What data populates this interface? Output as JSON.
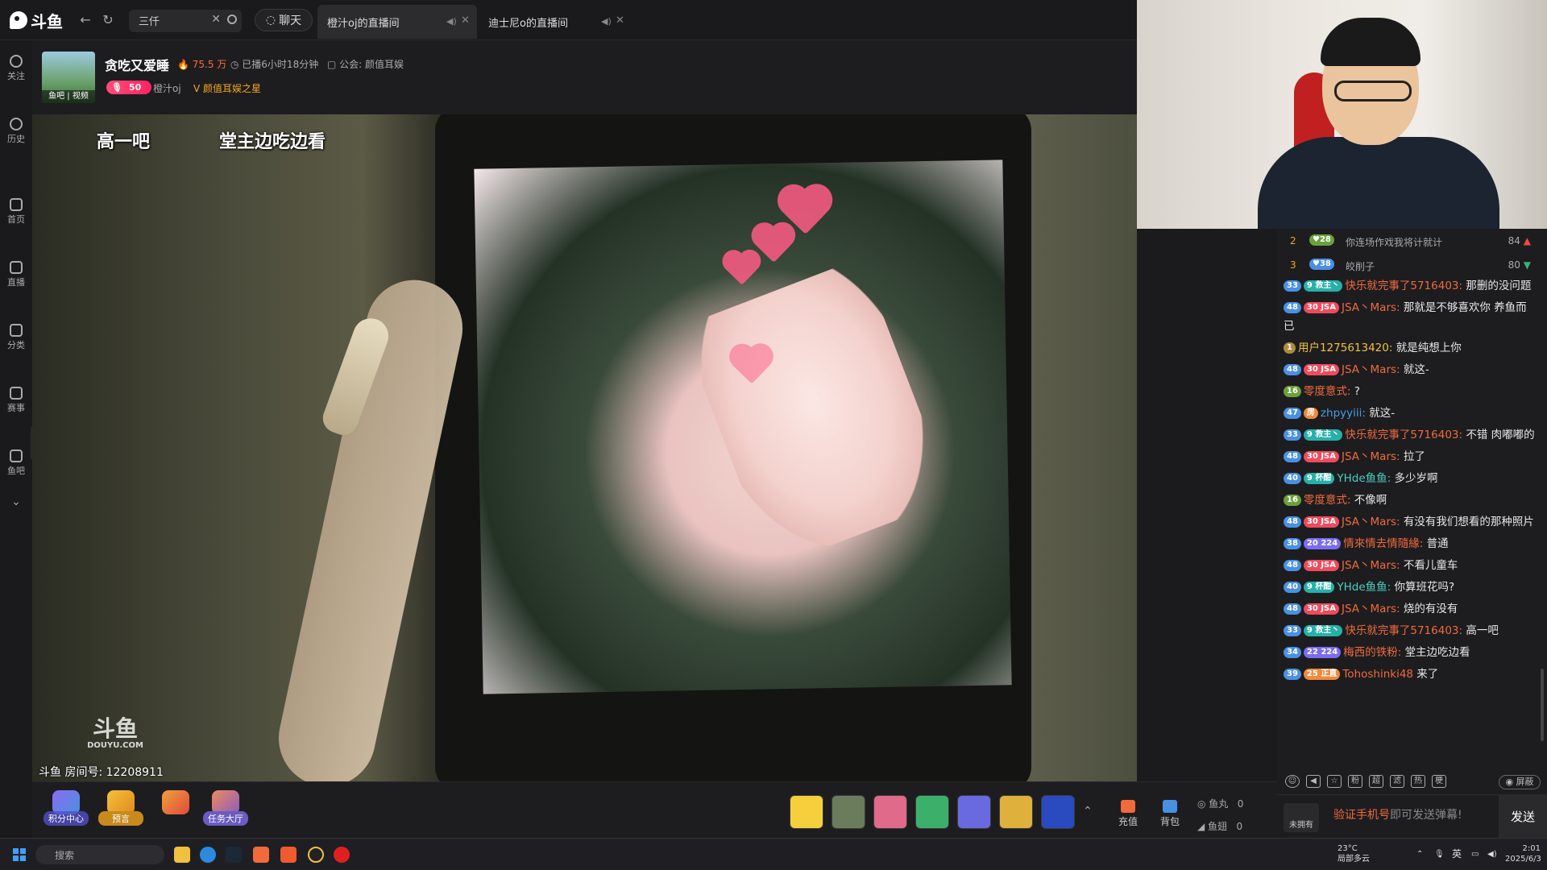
{
  "topbar": {
    "search_value": "三仟",
    "chat_label": "聊天",
    "tabs": [
      {
        "label": "橙汁oj的直播间"
      },
      {
        "label": "迪士尼o的直播间"
      }
    ]
  },
  "sidebar": {
    "items": [
      {
        "label": "关注",
        "icon": "heart-icon"
      },
      {
        "label": "历史",
        "icon": "clock-icon"
      },
      {
        "label": "首页",
        "icon": "home-icon"
      },
      {
        "label": "直播",
        "icon": "tv-icon"
      },
      {
        "label": "分类",
        "icon": "grid-icon"
      },
      {
        "label": "赛事",
        "icon": "trophy-icon"
      },
      {
        "label": "鱼吧",
        "icon": "fishbar-icon"
      }
    ]
  },
  "room": {
    "avatar_tag": "鱼吧 | 视频",
    "streamer_name": "贪吃又爱睡",
    "heat": "75.5 万",
    "live_time": "已播6小时18分钟",
    "guild": "公会: 颜值耳娱",
    "fan_level": "50",
    "fan_handle": "橙汁oj",
    "star_label": "颜值耳娱之星"
  },
  "video": {
    "overlay_left": "高一吧",
    "overlay_right": "堂主边吃边看",
    "watermark": "斗鱼",
    "watermark_sub": "DOUYU.COM",
    "room_number": "斗鱼 房间号: 12208911"
  },
  "giftbar": {
    "actions": [
      "积分中心",
      "预言",
      "",
      "任务大厅"
    ],
    "recharge": "充值",
    "backpack": "背包",
    "fishball_label": "鱼丸",
    "fishball_value": "0",
    "fishfin_label": "鱼翅",
    "fishfin_value": "0"
  },
  "chat": {
    "ranking": [
      {
        "rank": "2",
        "level": "28",
        "name": "你连场作戏我将计就计",
        "score": "84"
      },
      {
        "rank": "3",
        "level": "38",
        "name": "皎削子",
        "score": "80"
      }
    ],
    "messages": [
      {
        "level": "33",
        "fan": "9 救主丶",
        "user": "快乐就完事了5716403:",
        "text": "那删的没问题"
      },
      {
        "level": "48",
        "fan": "30 JSA",
        "user": "JSA丶Mars:",
        "text": "那就是不够喜欢你 养鱼而已"
      },
      {
        "level": "1",
        "fan": "",
        "user": "用户1275613420:",
        "text": "就是纯想上你"
      },
      {
        "level": "48",
        "fan": "30 JSA",
        "user": "JSA丶Mars:",
        "text": "就这-"
      },
      {
        "level": "16",
        "fan": "",
        "user": "零度意式:",
        "text": "?"
      },
      {
        "level": "47",
        "fan": "房",
        "user": "zhpyyiii:",
        "text": "就这-"
      },
      {
        "level": "33",
        "fan": "9 救主丶",
        "user": "快乐就完事了5716403:",
        "text": "不错 肉嘟嘟的"
      },
      {
        "level": "48",
        "fan": "30 JSA",
        "user": "JSA丶Mars:",
        "text": "拉了"
      },
      {
        "level": "40",
        "fan": "9 杯酣",
        "user": "YHde鱼鱼:",
        "text": "多少岁啊"
      },
      {
        "level": "16",
        "fan": "",
        "user": "零度意式:",
        "text": "不像啊"
      },
      {
        "level": "48",
        "fan": "30 JSA",
        "user": "JSA丶Mars:",
        "text": "有没有我们想看的那种照片"
      },
      {
        "level": "38",
        "fan": "20 224",
        "user": "情來情去情隨緣:",
        "text": "普通"
      },
      {
        "level": "48",
        "fan": "30 JSA",
        "user": "JSA丶Mars:",
        "text": "不看儿童车"
      },
      {
        "level": "40",
        "fan": "9 杯酣",
        "user": "YHde鱼鱼:",
        "text": "你算班花吗?"
      },
      {
        "level": "48",
        "fan": "30 JSA",
        "user": "JSA丶Mars:",
        "text": "烧的有没有"
      },
      {
        "level": "33",
        "fan": "9 救主丶",
        "user": "快乐就完事了5716403:",
        "text": "高一吧"
      },
      {
        "level": "34",
        "fan": "22 224",
        "user": "梅西的铁粉:",
        "text": "堂主边吃边看"
      },
      {
        "level": "39",
        "fan": "25 正直",
        "user": "Tohoshinki48",
        "text": "来了"
      }
    ],
    "tools": [
      "超",
      "热",
      "梗"
    ],
    "shield_label": "屏蔽",
    "not_owned": "未拥有",
    "verify_prefix": "验证手机号",
    "verify_suffix": "即可发送弹幕!",
    "send_label": "发送"
  },
  "taskbar": {
    "search_placeholder": "搜索",
    "weather": "23°C",
    "weather_sub": "局部多云",
    "lang": "英",
    "time": "2:01",
    "date": "2025/6/3"
  },
  "colors": {
    "accent": "#ff5c1c",
    "background": "#1b1b1d",
    "username": "#f06a3c"
  }
}
